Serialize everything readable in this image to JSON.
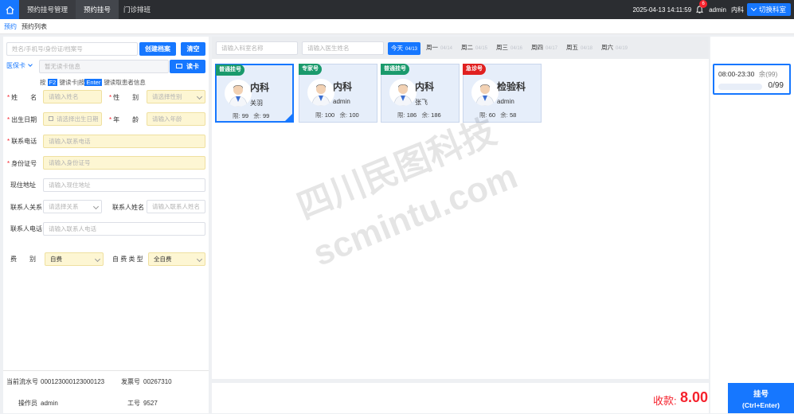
{
  "topbar": {
    "tabs": [
      {
        "label": "预约挂号管理"
      },
      {
        "label": "预约挂号"
      },
      {
        "label": "门诊排班"
      }
    ],
    "datetime": "2025-04-13 14:11:59",
    "notification_count": "6",
    "user": "admin",
    "department": "内科",
    "switch_dept_label": "切换科室"
  },
  "subtabs": [
    {
      "label": "预约"
    },
    {
      "label": "预约列表"
    }
  ],
  "patient_form": {
    "search_placeholder": "姓名/手机号/身份证/档案号",
    "create_button": "创建档案",
    "clear_button": "清空",
    "card_type": "医保卡",
    "card_info_placeholder": "暂无读卡信息",
    "read_card_button": "读卡",
    "hint_prefix": "按",
    "hint_key1": "F2",
    "hint_middle": "键读卡|按",
    "hint_key2": "Enter",
    "hint_suffix": "键读取患者信息",
    "name_label": "姓　　名",
    "name_placeholder": "请输入姓名",
    "gender_label": "性　　别",
    "gender_placeholder": "请选择性别",
    "birth_label": "出生日期",
    "birth_placeholder": "请选择出生日期",
    "age_label": "年　　龄",
    "age_placeholder": "请输入年龄",
    "phone_label": "联系电话",
    "phone_placeholder": "请输入联系电话",
    "id_label": "身份证号",
    "id_placeholder": "请输入身份证号",
    "address_label": "现住地址",
    "address_placeholder": "请输入现住地址",
    "relation_label": "联系人关系",
    "relation_placeholder": "请选择关系",
    "contact_name_label": "联系人姓名",
    "contact_name_placeholder": "请输入联系人姓名",
    "contact_phone_label": "联系人电话",
    "contact_phone_placeholder": "请输入联系人电话",
    "fee_label": "费　　别",
    "fee_value": "自费",
    "selfpay_label": "自 费 类 型",
    "selfpay_value": "全自费"
  },
  "footer_info": {
    "serial_label": "当前流水号",
    "serial_value": "000123000123000123",
    "invoice_label": "发票号",
    "invoice_value": "00267310",
    "operator_label": "操作员",
    "operator_value": "admin",
    "staff_label": "工号",
    "staff_value": "9527"
  },
  "schedule": {
    "dept_search_placeholder": "请输入科室名称",
    "doctor_search_placeholder": "请输入医生姓名",
    "days": [
      {
        "label": "今天",
        "date": "04/13"
      },
      {
        "label": "周一",
        "date": "04/14"
      },
      {
        "label": "周二",
        "date": "04/15"
      },
      {
        "label": "周三",
        "date": "04/16"
      },
      {
        "label": "周四",
        "date": "04/17"
      },
      {
        "label": "周五",
        "date": "04/18"
      },
      {
        "label": "周六",
        "date": "04/19"
      }
    ],
    "cards": [
      {
        "tag": "普通挂号",
        "tag_color": "#1a9a6c",
        "dept": "内科",
        "doctor": "关羽",
        "limit_label": "限:",
        "limit": "99",
        "remain_label": "余:",
        "remain": "99"
      },
      {
        "tag": "专家号",
        "tag_color": "#1a9a6c",
        "dept": "内科",
        "doctor": "admin",
        "limit_label": "限:",
        "limit": "100",
        "remain_label": "余:",
        "remain": "100"
      },
      {
        "tag": "普通挂号",
        "tag_color": "#1a9a6c",
        "dept": "内科",
        "doctor": "张飞",
        "limit_label": "限:",
        "limit": "186",
        "remain_label": "余:",
        "remain": "186"
      },
      {
        "tag": "急诊号",
        "tag_color": "#e02020",
        "dept": "检验科",
        "doctor": "admin",
        "limit_label": "限:",
        "limit": "60",
        "remain_label": "余:",
        "remain": "58"
      }
    ]
  },
  "time_slot": {
    "time": "08:00-23:30",
    "remain_label": "余(99)",
    "count": "0/99",
    "fill_fraction": 0
  },
  "payment": {
    "label": "收款:",
    "amount": "8.00",
    "submit_label": "挂号",
    "submit_shortcut": "(Ctrl+Enter)"
  },
  "watermark": {
    "line1": "四川民图科技",
    "line2": "scmintu.com"
  },
  "colors": {
    "primary": "#1677ff",
    "topbar": "#2b2d31",
    "required": "#f5222d",
    "amount": "#f5222d",
    "tag_green": "#1a9a6c",
    "tag_red": "#e02020"
  }
}
